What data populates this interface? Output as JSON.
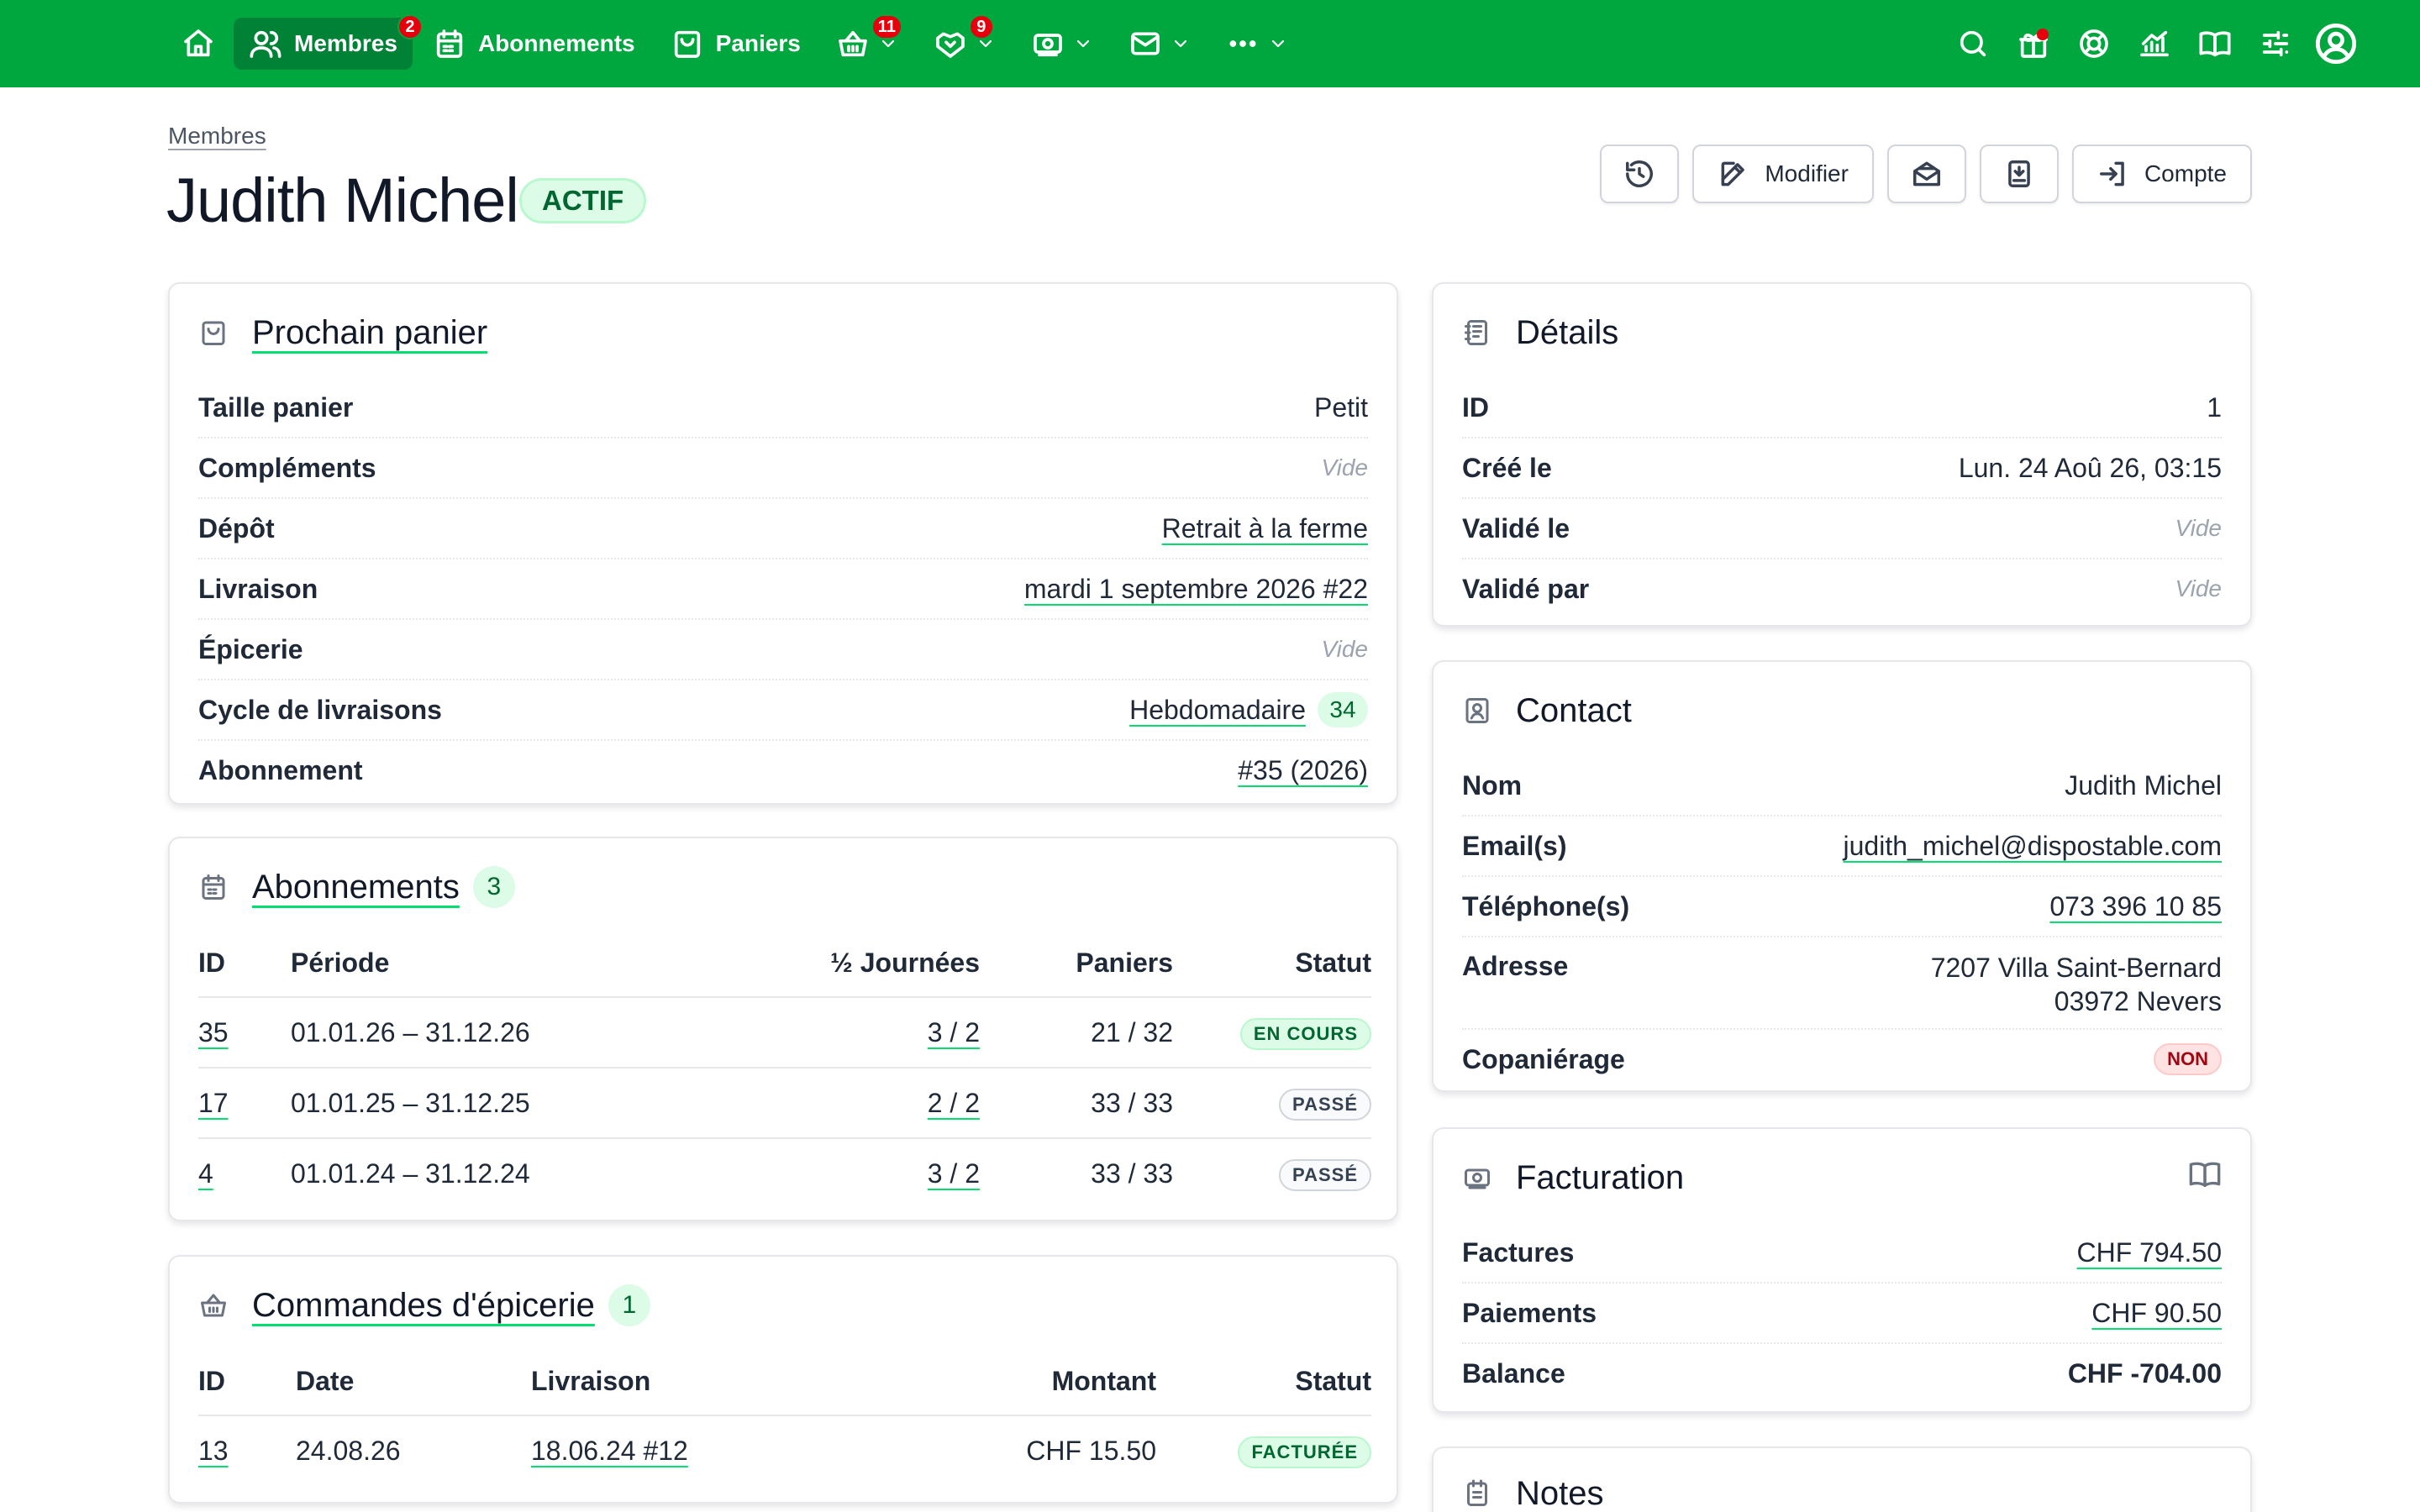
{
  "nav": {
    "members_label": "Membres",
    "members_badge": "2",
    "subscriptions_label": "Abonnements",
    "baskets_label": "Paniers",
    "shop_badge": "11",
    "activities_badge": "9"
  },
  "header": {
    "breadcrumb": "Membres",
    "title": "Judith Michel",
    "status": "ACTIF",
    "edit_label": "Modifier",
    "account_label": "Compte"
  },
  "next_basket": {
    "title": "Prochain panier",
    "rows": [
      {
        "key": "Taille panier",
        "value": "Petit"
      },
      {
        "key": "Compléments",
        "value": "Vide"
      },
      {
        "key": "Dépôt",
        "value": "Retrait à la ferme"
      },
      {
        "key": "Livraison",
        "value": "mardi 1 septembre 2026 #22"
      },
      {
        "key": "Épicerie",
        "value": "Vide"
      },
      {
        "key": "Cycle de livraisons",
        "value": "Hebdomadaire",
        "badge": "34"
      },
      {
        "key": "Abonnement",
        "value": "#35 (2026)"
      }
    ]
  },
  "subscriptions": {
    "title": "Abonnements",
    "count": "3",
    "headers": {
      "id": "ID",
      "period": "Période",
      "half_days": "½ Journées",
      "baskets": "Paniers",
      "status": "Statut"
    },
    "rows": [
      {
        "id": "35",
        "period": "01.01.26 – 31.12.26",
        "half_days": "3 / 2",
        "baskets": "21 / 32",
        "status": "EN COURS"
      },
      {
        "id": "17",
        "period": "01.01.25 – 31.12.25",
        "half_days": "2 / 2",
        "baskets": "33 / 33",
        "status": "PASSÉ"
      },
      {
        "id": "4",
        "period": "01.01.24 – 31.12.24",
        "half_days": "3 / 2",
        "baskets": "33 / 33",
        "status": "PASSÉ"
      }
    ]
  },
  "shop_orders": {
    "title": "Commandes d'épicerie",
    "count": "1",
    "headers": {
      "id": "ID",
      "date": "Date",
      "delivery": "Livraison",
      "amount": "Montant",
      "status": "Statut"
    },
    "rows": [
      {
        "id": "13",
        "date": "24.08.26",
        "delivery": "18.06.24 #12",
        "amount": "CHF 15.50",
        "status": "FACTURÉE"
      }
    ]
  },
  "details": {
    "title": "Détails",
    "rows": [
      {
        "key": "ID",
        "value": "1"
      },
      {
        "key": "Créé le",
        "value": "Lun. 24 Aoû 26, 03:15"
      },
      {
        "key": "Validé le",
        "value": "Vide"
      },
      {
        "key": "Validé par",
        "value": "Vide"
      }
    ]
  },
  "contact": {
    "title": "Contact",
    "name_key": "Nom",
    "name": "Judith Michel",
    "email_key": "Email(s)",
    "email": "judith_michel@dispostable.com",
    "phone_key": "Téléphone(s)",
    "phone": "073 396 10 85",
    "address_key": "Adresse",
    "address_line1": "7207 Villa Saint-Bernard",
    "address_line2": "03972 Nevers",
    "copartner_key": "Copaniérage",
    "copartner": "NON"
  },
  "billing": {
    "title": "Facturation",
    "invoices_key": "Factures",
    "invoices": "CHF 794.50",
    "payments_key": "Paiements",
    "payments": "CHF 90.50",
    "balance_key": "Balance",
    "balance": "CHF -704.00"
  },
  "notes": {
    "title": "Notes"
  },
  "colors": {
    "brand": "#00a63e",
    "brand_dark": "#008236",
    "success_bg": "#dcfce7",
    "danger": "#e7000b"
  }
}
